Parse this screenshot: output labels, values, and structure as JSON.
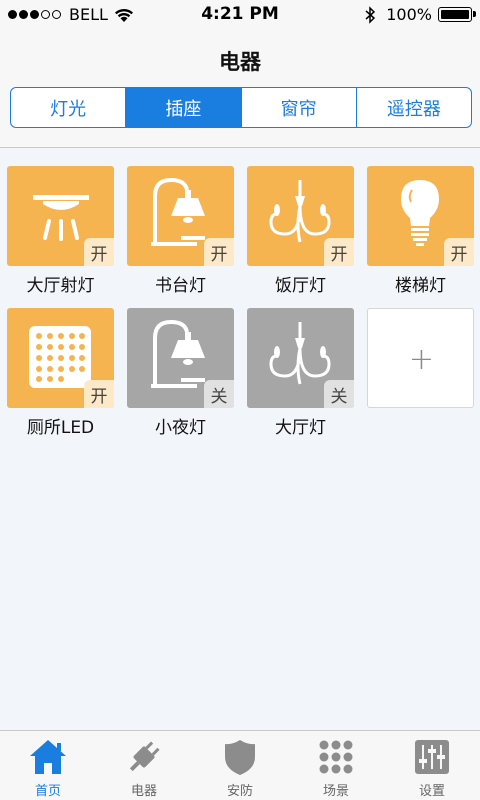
{
  "status": {
    "carrier": "BELL",
    "time": "4:21 PM",
    "battery": "100%",
    "signal_bars": 3,
    "signal_total": 5
  },
  "nav": {
    "title": "电器",
    "segments": [
      "灯光",
      "插座",
      "窗帘",
      "遥控器"
    ],
    "active_segment": 1
  },
  "devices": [
    {
      "label": "大厅射灯",
      "state": "开",
      "on": true,
      "icon": "spotlight-icon"
    },
    {
      "label": "书台灯",
      "state": "开",
      "on": true,
      "icon": "desk-lamp-icon"
    },
    {
      "label": "饭厅灯",
      "state": "开",
      "on": true,
      "icon": "chandelier-icon"
    },
    {
      "label": "楼梯灯",
      "state": "开",
      "on": true,
      "icon": "bulb-icon"
    },
    {
      "label": "厕所LED",
      "state": "开",
      "on": true,
      "icon": "led-panel-icon"
    },
    {
      "label": "小夜灯",
      "state": "关",
      "on": false,
      "icon": "desk-lamp-icon"
    },
    {
      "label": "大厅灯",
      "state": "关",
      "on": false,
      "icon": "chandelier-icon"
    }
  ],
  "add_tile": {
    "symbol": "+"
  },
  "tabs": [
    {
      "label": "首页",
      "icon": "home-icon",
      "active": true
    },
    {
      "label": "电器",
      "icon": "plug-icon",
      "active": false
    },
    {
      "label": "安防",
      "icon": "shield-icon",
      "active": false
    },
    {
      "label": "场景",
      "icon": "grid-dots-icon",
      "active": false
    },
    {
      "label": "设置",
      "icon": "sliders-icon",
      "active": false
    }
  ],
  "colors": {
    "accent": "#1a7de0",
    "tile_on": "#f6b451",
    "tile_off": "#a6a6a6"
  }
}
